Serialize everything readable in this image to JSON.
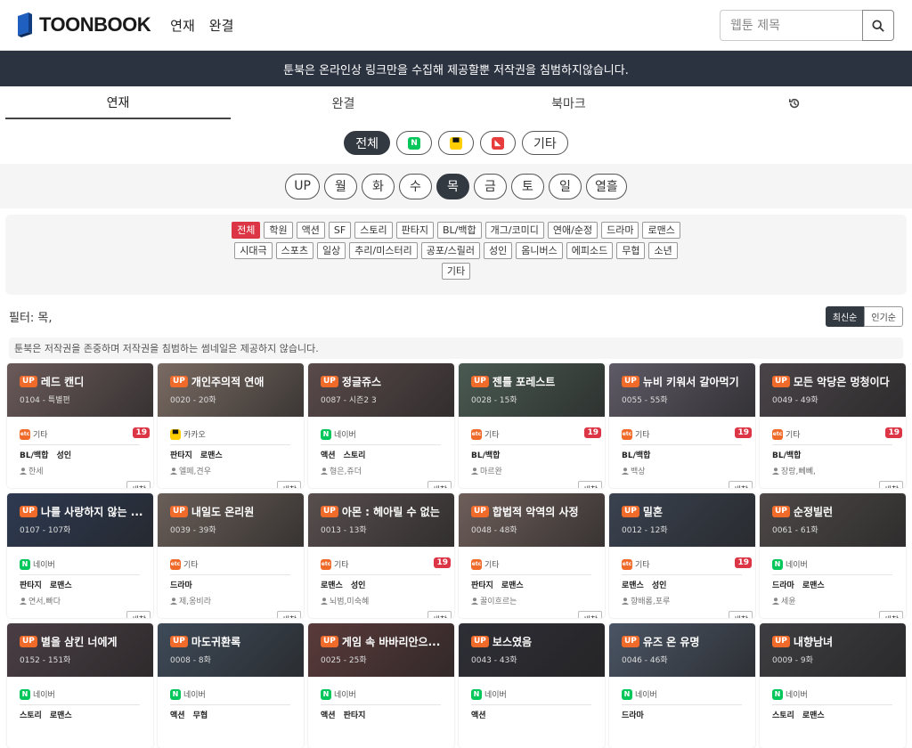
{
  "brand": {
    "name": "TOONBOOK"
  },
  "topnav": [
    "연재",
    "완결"
  ],
  "search": {
    "placeholder": "웹툰 제목"
  },
  "notice": "툰북은 온라인상 링크만을 수집해 제공할뿐 저작권을 침범하지않습니다.",
  "tabs": [
    "연재",
    "완결",
    "북마크"
  ],
  "platforms": [
    {
      "label": "전체",
      "active": true
    },
    {
      "icon": "naver-icon",
      "letter": "N",
      "color": "#03c75a"
    },
    {
      "icon": "kakao-icon",
      "letter": "▀",
      "color": "#ffcd00"
    },
    {
      "icon": "toptoon-icon",
      "letter": "◣",
      "color": "#e73c3c"
    },
    {
      "label": "기타"
    }
  ],
  "days": [
    "UP",
    "월",
    "화",
    "수",
    "목",
    "금",
    "토",
    "일",
    "열흘"
  ],
  "active_day": "목",
  "genres": [
    [
      "전체",
      "학원",
      "액션",
      "SF",
      "스토리",
      "판타지",
      "BL/백합",
      "개그/코미디",
      "연애/순정",
      "드라마",
      "로맨스"
    ],
    [
      "시대극",
      "스포츠",
      "일상",
      "추리/미스터리",
      "공포/스릴러",
      "성인",
      "옴니버스",
      "에피소드",
      "무협",
      "소년"
    ],
    [
      "기타"
    ]
  ],
  "filter_text": "필터: 목,",
  "sort": [
    "최신순",
    "인기순"
  ],
  "copyright": "툰북은 저작권을 존중하며 저작권을 침범하는 썸네일은 제공하지 않습니다.",
  "up_label": "UP",
  "new_label": "새창",
  "cards": [
    {
      "title": "레드 캔디",
      "sub": "0104 - 특별편",
      "platform": "기타",
      "ptype": "etc",
      "adult": "19",
      "tags": [
        "BL/백합",
        "성인"
      ],
      "author": "한세",
      "bg": "#6b5a5a"
    },
    {
      "title": "개인주의적 연애",
      "sub": "0020 - 20화",
      "platform": "카카오",
      "ptype": "kakao",
      "adult": "",
      "tags": [
        "판타지",
        "로맨스"
      ],
      "author": "엘페,견우",
      "bg": "#7a6b63"
    },
    {
      "title": "정글쥬스",
      "sub": "0087 - 시즌2 3",
      "platform": "네이버",
      "ptype": "naver",
      "adult": "",
      "tags": [
        "액션",
        "스토리"
      ],
      "author": "형은,쥬더",
      "bg": "#5a4a4a"
    },
    {
      "title": "젠틀 포레스트",
      "sub": "0028 - 15화",
      "platform": "기타",
      "ptype": "etc",
      "adult": "19",
      "tags": [
        "BL/백합"
      ],
      "author": "마르완",
      "bg": "#4a5a52"
    },
    {
      "title": "뉴비 키워서 갈아먹기",
      "sub": "0055 - 55화",
      "platform": "기타",
      "ptype": "etc",
      "adult": "19",
      "tags": [
        "BL/백합"
      ],
      "author": "백상",
      "bg": "#5e5a66"
    },
    {
      "title": "모든 악당은 멍청이다",
      "sub": "0049 - 49화",
      "platform": "기타",
      "ptype": "etc",
      "adult": "19",
      "tags": [
        "BL/백합"
      ],
      "author": "장랑,뻬뻬,",
      "bg": "#4a4448"
    },
    {
      "title": "나를 사랑하지 않는 ...",
      "sub": "0107 - 107화",
      "platform": "네이버",
      "ptype": "naver",
      "adult": "",
      "tags": [
        "판타지",
        "로맨스"
      ],
      "author": "연서,빠다",
      "bg": "#2e3a52"
    },
    {
      "title": "내일도 온리원",
      "sub": "0039 - 39화",
      "platform": "기타",
      "ptype": "etc",
      "adult": "",
      "tags": [
        "드라마"
      ],
      "author": "제,옹비라",
      "bg": "#6a5e58"
    },
    {
      "title": "아몬 : 헤아릴 수 없는",
      "sub": "0013 - 13화",
      "platform": "기타",
      "ptype": "etc",
      "adult": "19",
      "tags": [
        "로맨스",
        "성인"
      ],
      "author": "뇌범,미숙혜",
      "bg": "#584e4e"
    },
    {
      "title": "합법적 악역의 사정",
      "sub": "0048 - 48화",
      "platform": "기타",
      "ptype": "etc",
      "adult": "",
      "tags": [
        "판타지",
        "로맨스"
      ],
      "author": "꿀이흐르는",
      "bg": "#6e5e5a"
    },
    {
      "title": "밀혼",
      "sub": "0012 - 12화",
      "platform": "기타",
      "ptype": "etc",
      "adult": "19",
      "tags": [
        "로맨스",
        "성인"
      ],
      "author": "향배롬,포루",
      "bg": "#3a4250"
    },
    {
      "title": "순정빌런",
      "sub": "0061 - 61화",
      "platform": "네이버",
      "ptype": "naver",
      "adult": "",
      "tags": [
        "드라마",
        "로맨스"
      ],
      "author": "세윤",
      "bg": "#4e4848"
    },
    {
      "title": "별을 삼킨 너에게",
      "sub": "0152 - 151화",
      "platform": "네이버",
      "ptype": "naver",
      "adult": "",
      "tags": [
        "스토리",
        "로맨스"
      ],
      "author": "",
      "bg": "#4a3e44"
    },
    {
      "title": "마도귀환록",
      "sub": "0008 - 8화",
      "platform": "네이버",
      "ptype": "naver",
      "adult": "",
      "tags": [
        "액션",
        "무협"
      ],
      "author": "",
      "bg": "#3e4a58"
    },
    {
      "title": "게임 속 바바리안으...",
      "sub": "0025 - 25화",
      "platform": "네이버",
      "ptype": "naver",
      "adult": "",
      "tags": [
        "액션",
        "판타지"
      ],
      "author": "",
      "bg": "#5a3a3a"
    },
    {
      "title": "보스였음",
      "sub": "0043 - 43화",
      "platform": "네이버",
      "ptype": "naver",
      "adult": "",
      "tags": [
        "액션"
      ],
      "author": "",
      "bg": "#2e2e36"
    },
    {
      "title": "유즈 온 유명",
      "sub": "0046 - 46화",
      "platform": "네이버",
      "ptype": "naver",
      "adult": "",
      "tags": [
        "드라마"
      ],
      "author": "",
      "bg": "#4a5464"
    },
    {
      "title": "내향남녀",
      "sub": "0009 - 9화",
      "platform": "네이버",
      "ptype": "naver",
      "adult": "",
      "tags": [
        "스토리",
        "로맨스"
      ],
      "author": "",
      "bg": "#3e3e42"
    }
  ]
}
